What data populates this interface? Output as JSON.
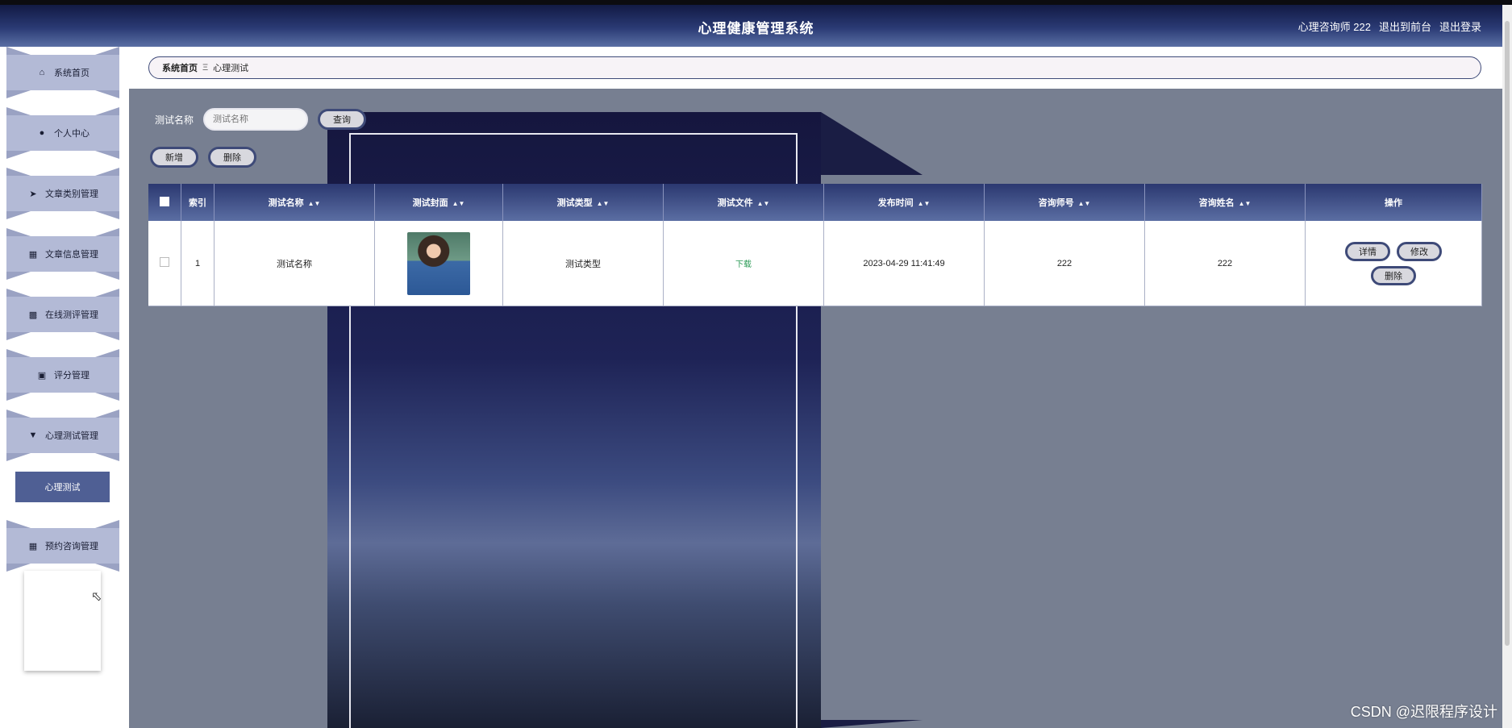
{
  "header": {
    "title": "心理健康管理系统",
    "user": "心理咨询师 222",
    "to_front": "退出到前台",
    "logout": "退出登录"
  },
  "sidebar": {
    "items": [
      {
        "label": "系统首页",
        "icon": "home-icon"
      },
      {
        "label": "个人中心",
        "icon": "user-icon"
      },
      {
        "label": "文章类别管理",
        "icon": "send-icon"
      },
      {
        "label": "文章信息管理",
        "icon": "grid-icon"
      },
      {
        "label": "在线测评管理",
        "icon": "briefcase-icon"
      },
      {
        "label": "评分管理",
        "icon": "chart-icon"
      },
      {
        "label": "心理测试管理",
        "icon": "cup-icon"
      },
      {
        "label": "预约咨询管理",
        "icon": "apps-icon"
      }
    ],
    "active_sub": "心理测试"
  },
  "breadcrumb": {
    "home": "系统首页",
    "separator": "Ξ",
    "current": "心理测试"
  },
  "search": {
    "label": "测试名称",
    "placeholder": "测试名称",
    "button": "查询"
  },
  "actions": {
    "add": "新增",
    "delete": "删除"
  },
  "table": {
    "columns": [
      "索引",
      "测试名称",
      "测试封面",
      "测试类型",
      "测试文件",
      "发布时间",
      "咨询师号",
      "咨询姓名",
      "操作"
    ],
    "rows": [
      {
        "index": "1",
        "name": "测试名称",
        "type": "测试类型",
        "file": "下载",
        "time": "2023-04-29 11:41:49",
        "counselor_no": "222",
        "counselor_name": "222"
      }
    ],
    "row_actions": {
      "detail": "详情",
      "edit": "修改",
      "delete": "删除"
    }
  },
  "watermark": "CSDN @迟限程序设计"
}
